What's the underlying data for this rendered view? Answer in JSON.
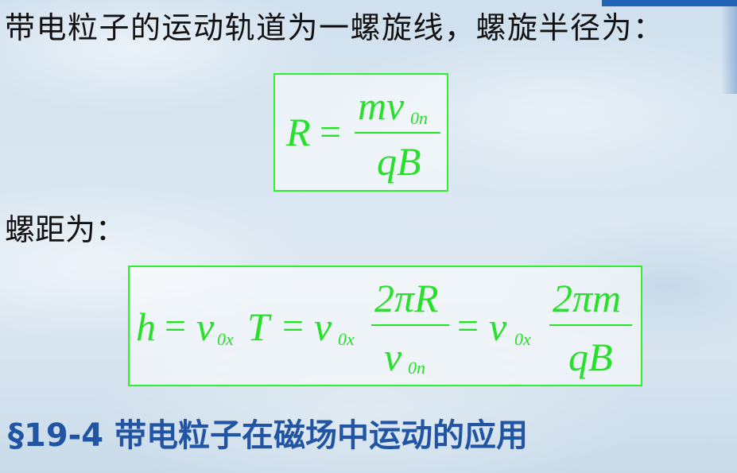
{
  "intro_text": "带电粒子的运动轨道为一螺旋线，螺旋半径为：",
  "pitch_label": "螺距为：",
  "section_title": "§19-4  带电粒子在磁场中运动的应用",
  "formula_radius": {
    "lhs": "R",
    "equals": "=",
    "numerator": "mv",
    "numerator_sub": "0n",
    "denominator": "qB"
  },
  "formula_pitch": {
    "lhs": "h",
    "eq1": "=",
    "term1": "v",
    "term1_sub": "0x",
    "term1_T": "T",
    "eq2": "=",
    "term2": "v",
    "term2_sub": "0x",
    "frac1_num": "2πR",
    "frac1_den": "v",
    "frac1_den_sub": "0n",
    "eq3": "=",
    "term3": "v",
    "term3_sub": "0x",
    "frac2_num": "2πm",
    "frac2_den": "qB"
  },
  "colors": {
    "formula_green": "#27e02a",
    "box_border": "#2ff02f",
    "section_blue": "#2155a3",
    "text": "#111111"
  }
}
